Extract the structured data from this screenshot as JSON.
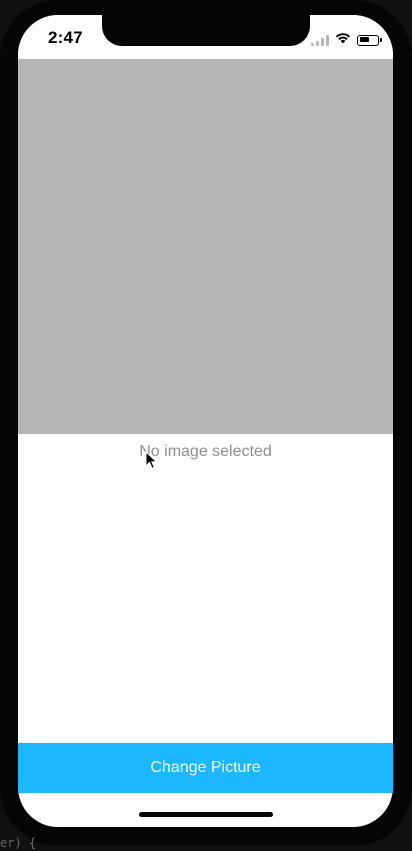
{
  "status_bar": {
    "time": "2:47",
    "icons": [
      "cellular-signal-icon",
      "wifi-icon",
      "battery-icon"
    ]
  },
  "image_view": {
    "empty_text": "No image selected",
    "placeholder_color": "#b5b5b5"
  },
  "actions": {
    "change_picture_label": "Change Picture",
    "button_color": "#1db7ff"
  },
  "background_code": {
    "text": "er) {"
  }
}
